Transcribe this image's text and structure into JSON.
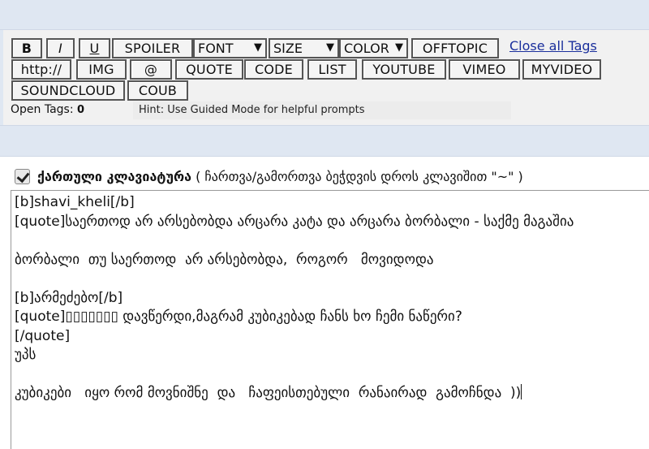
{
  "toolbar": {
    "buttons_row1": {
      "bold": "B",
      "italic": "I",
      "underline": "U",
      "spoiler": "SPOILER",
      "offtopic": "OFFTOPIC"
    },
    "selects": {
      "font": "FONT",
      "size": "SIZE",
      "color": "COLOR"
    },
    "close_all_tags": "Close all Tags",
    "buttons_row2": {
      "http": "http://",
      "img": "IMG",
      "at": "@",
      "quote": "QUOTE",
      "code": "CODE",
      "list": "LIST",
      "youtube": "YOUTUBE",
      "vimeo": "VIMEO",
      "myvideo": "MYVIDEO"
    },
    "buttons_row3": {
      "soundcloud": "SOUNDCLOUD",
      "coub": "COUB"
    }
  },
  "status": {
    "open_tags_label": "Open Tags:",
    "open_tags_count": "0",
    "hint": "Hint: Use Guided Mode for helpful prompts"
  },
  "keyboard": {
    "checked": true,
    "label": "ქართული კლავიატურა",
    "note": "( ჩართვა/გამორთვა ბეჭდვის დროს კლავიშით \"~\" )"
  },
  "editor": {
    "lines": [
      "[b]shavi_kheli[/b]",
      "[quote]საერთოდ არ არსებობდა არცარა კატა და არცარა ბორბალი - საქმე მაგაშია",
      "",
      "ბორბალი  თუ საერთოდ  არ არსებობდა,  როგორ   მოვიდოდა",
      "",
      "[b]არმეძებო[/b]",
      "[quote]▯▯▯▯▯▯▯ დავწერდი,მაგრამ კუბიკებად ჩანს ხო ჩემი ნაწერი?",
      "[/quote]",
      "უპს",
      "",
      "კუბიკები   იყო რომ მოვნიშნე  და   ჩაფეისთებული  რანაირად  გამოჩნდა  ))"
    ]
  }
}
